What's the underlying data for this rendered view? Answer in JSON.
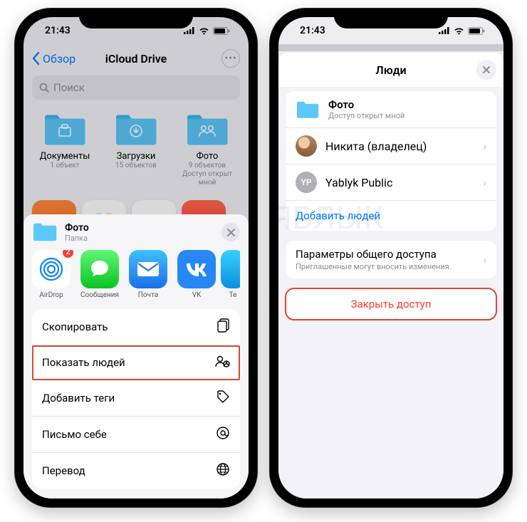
{
  "status": {
    "time": "21:43"
  },
  "left": {
    "nav_back": "Обзор",
    "nav_title": "iCloud Drive",
    "search_placeholder": "Поиск",
    "folders": [
      {
        "name": "Документы",
        "info": "1 объект"
      },
      {
        "name": "Загрузки",
        "info": "15 объектов"
      },
      {
        "name": "Фото",
        "info": "9 объектов\nДоступ открыт мной"
      }
    ],
    "share": {
      "title": "Фото",
      "subtitle": "Папка",
      "apps": [
        {
          "label": "AirDrop",
          "badge": "2"
        },
        {
          "label": "Сообщения"
        },
        {
          "label": "Почта"
        },
        {
          "label": "VK"
        },
        {
          "label": "Te"
        }
      ],
      "actions": [
        {
          "label": "Скопировать",
          "icon": "copy"
        },
        {
          "label": "Показать людей",
          "icon": "people",
          "highlight": true
        },
        {
          "label": "Добавить теги",
          "icon": "tag"
        },
        {
          "label": "Письмо себе",
          "icon": "at"
        },
        {
          "label": "Перевод",
          "icon": "globe"
        }
      ]
    }
  },
  "right": {
    "title": "Люди",
    "folder": {
      "name": "Фото",
      "subtitle": "Доступ открыт мной"
    },
    "people": [
      {
        "name": "Никита (владелец)",
        "avatar": "photo"
      },
      {
        "name": "Yablyk Public",
        "avatar": "yp",
        "initials": "YP"
      }
    ],
    "add_people": "Добавить людей",
    "params_title": "Параметры общего доступа",
    "params_sub": "Приглашенные могут вносить изменения.",
    "stop": "Закрыть доступ"
  },
  "watermark": "ЯБЛЫК"
}
